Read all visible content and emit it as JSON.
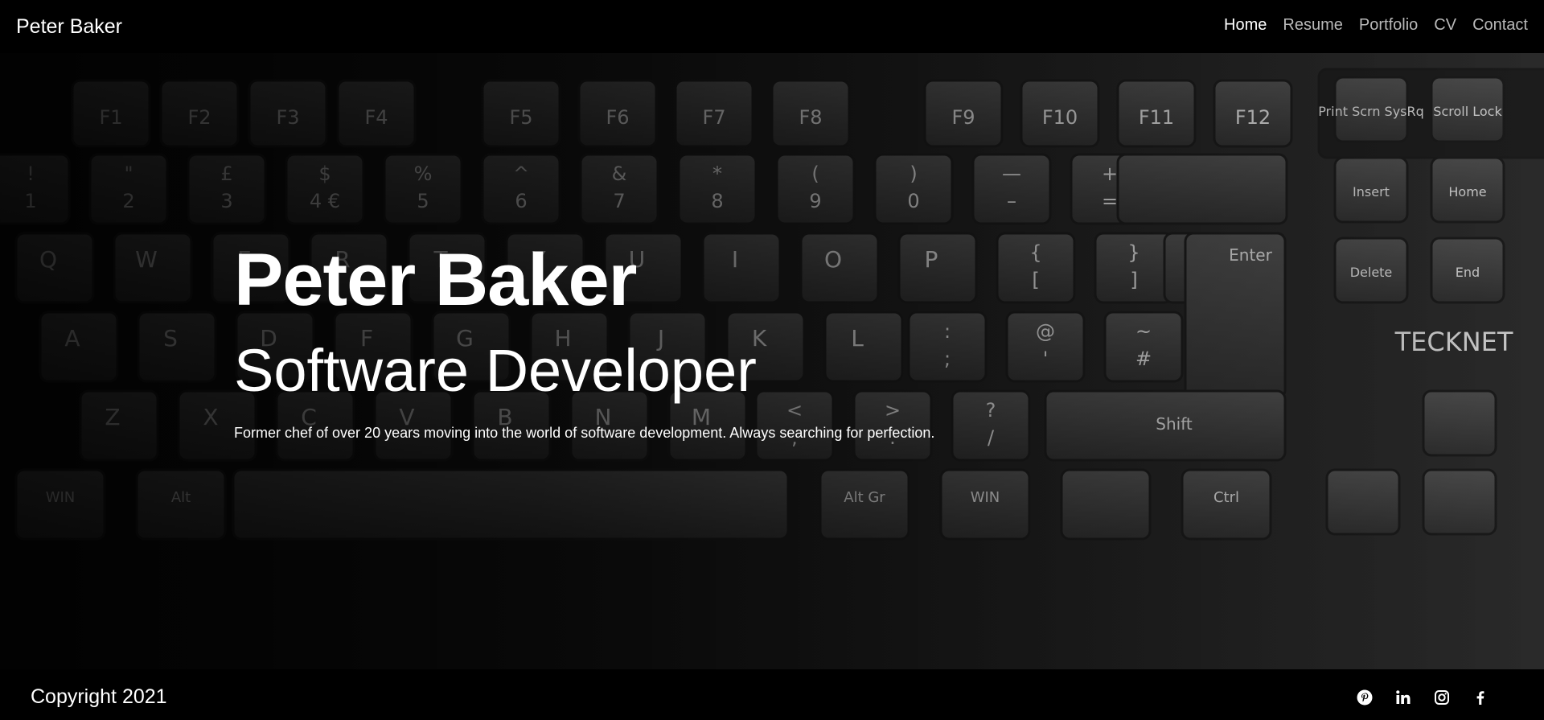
{
  "header": {
    "brand": "Peter Baker",
    "nav": [
      {
        "label": "Home",
        "active": true
      },
      {
        "label": "Resume",
        "active": false
      },
      {
        "label": "Portfolio",
        "active": false
      },
      {
        "label": "CV",
        "active": false
      },
      {
        "label": "Contact",
        "active": false
      }
    ]
  },
  "hero": {
    "name": "Peter Baker",
    "role": "Software Developer",
    "tagline": "Former chef of over 20 years moving into the world of software development. Always searching for perfection.",
    "background": {
      "keyboard_brand": "TECKNET",
      "fn_keys": [
        "F1",
        "F2",
        "F3",
        "F4",
        "F5",
        "F6",
        "F7",
        "F8",
        "F9",
        "F10",
        "F11",
        "F12"
      ],
      "number_row": [
        {
          "top": "!",
          "bottom": "1"
        },
        {
          "top": "\"",
          "bottom": "2"
        },
        {
          "top": "£",
          "bottom": "3"
        },
        {
          "top": "$",
          "bottom": "4 €"
        },
        {
          "top": "%",
          "bottom": "5"
        },
        {
          "top": "^",
          "bottom": "6"
        },
        {
          "top": "&",
          "bottom": "7"
        },
        {
          "top": "*",
          "bottom": "8"
        },
        {
          "top": "(",
          "bottom": "9"
        },
        {
          "top": ")",
          "bottom": "0"
        },
        {
          "top": "—",
          "bottom": "–"
        },
        {
          "top": "+",
          "bottom": "="
        }
      ],
      "row_q": [
        "Q",
        "W",
        "E",
        "R",
        "T",
        "Y",
        "U",
        "I",
        "O",
        "P"
      ],
      "row_q_brackets": [
        {
          "top": "{",
          "bottom": "["
        },
        {
          "top": "}",
          "bottom": "]"
        }
      ],
      "row_a": [
        "A",
        "S",
        "D",
        "F",
        "G",
        "H",
        "J",
        "K",
        "L"
      ],
      "row_a_symbols": [
        {
          "top": ":",
          "bottom": ";"
        },
        {
          "top": "@",
          "bottom": "'"
        },
        {
          "top": "~",
          "bottom": "#"
        }
      ],
      "row_z": [
        "Z",
        "X",
        "C",
        "V",
        "B",
        "N",
        "M"
      ],
      "row_z_symbols": [
        {
          "top": "<",
          "bottom": ","
        },
        {
          "top": ">",
          "bottom": "."
        },
        {
          "top": "?",
          "bottom": "/"
        }
      ],
      "row_bottom": [
        "WIN",
        "Alt",
        "Alt Gr",
        "WIN",
        "Ctrl"
      ],
      "nav_keys": [
        "Print Scrn SysRq",
        "Scroll Lock",
        "Insert",
        "Home",
        "Delete",
        "End"
      ],
      "enter": "Enter",
      "shift": "Shift"
    }
  },
  "footer": {
    "copyright": "Copyright 2021",
    "social": [
      {
        "name": "pinterest-icon",
        "label": "Pinterest"
      },
      {
        "name": "linkedin-icon",
        "label": "LinkedIn"
      },
      {
        "name": "instagram-icon",
        "label": "Instagram"
      },
      {
        "name": "facebook-icon",
        "label": "Facebook"
      }
    ]
  }
}
